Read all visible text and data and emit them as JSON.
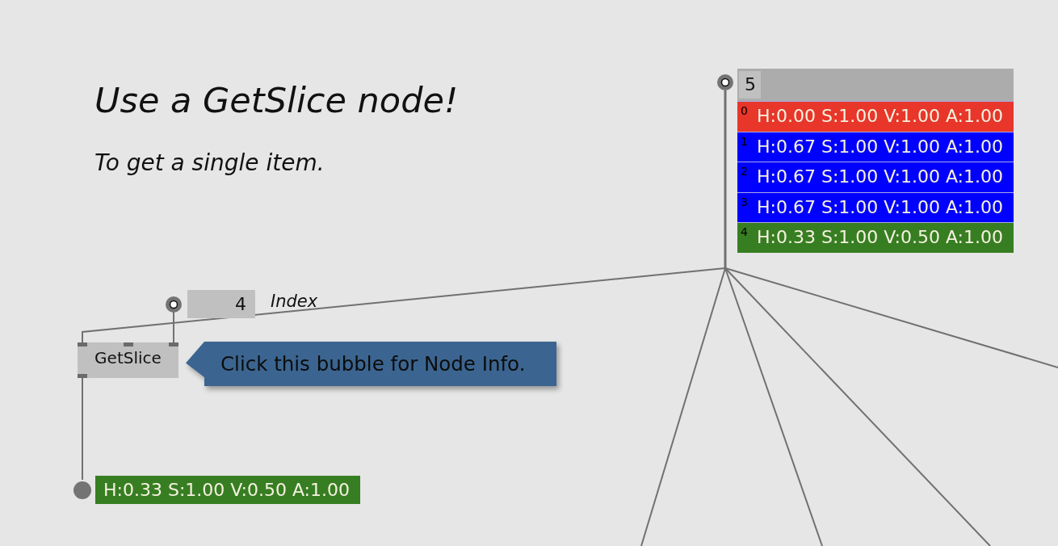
{
  "canvas": {
    "heading": "Use a GetSlice node!",
    "subheading": "To get a single item.",
    "spread_iobox": {
      "count": "5",
      "slices": [
        {
          "index": "0",
          "value": "H:0.00 S:1.00 V:1.00 A:1.00",
          "color": "#e8362a"
        },
        {
          "index": "1",
          "value": "H:0.67 S:1.00 V:1.00 A:1.00",
          "color": "#0000ff"
        },
        {
          "index": "2",
          "value": "H:0.67 S:1.00 V:1.00 A:1.00",
          "color": "#0000ff"
        },
        {
          "index": "3",
          "value": "H:0.67 S:1.00 V:1.00 A:1.00",
          "color": "#0000ff"
        },
        {
          "index": "4",
          "value": "H:0.33 S:1.00 V:0.50 A:1.00",
          "color": "#377e22"
        }
      ]
    },
    "index_iobox": {
      "value": "4",
      "label": "Index"
    },
    "node": {
      "title": "GetSlice"
    },
    "info_bubble": {
      "text": "Click this bubble for Node Info."
    },
    "output_iobox": {
      "value": "H:0.33 S:1.00 V:0.50 A:1.00",
      "color": "#377e22"
    }
  }
}
